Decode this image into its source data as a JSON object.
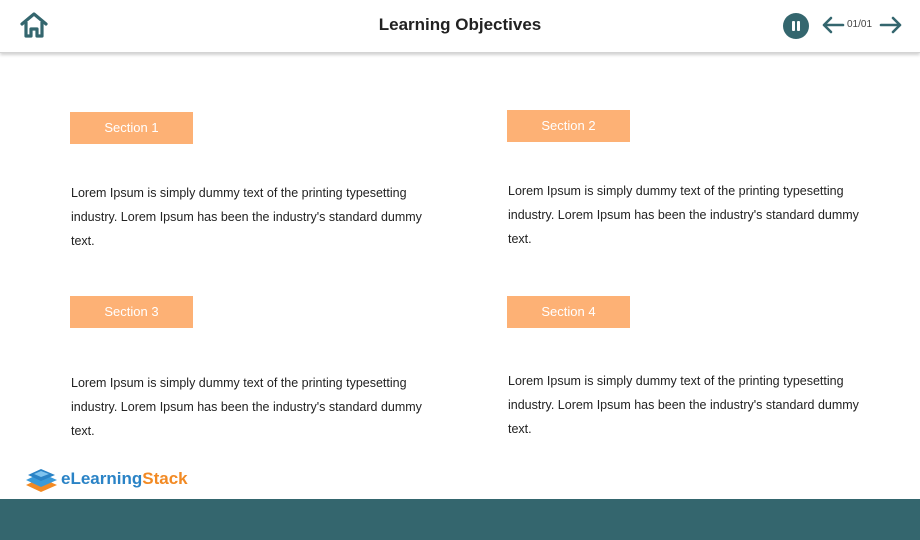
{
  "header": {
    "title": "Learning Objectives",
    "page_counter": "01/01",
    "icons": {
      "home": "home-icon",
      "pause": "pause-icon",
      "prev": "arrow-left-icon",
      "next": "arrow-right-icon"
    }
  },
  "sections": [
    {
      "label": "Section 1",
      "text": "Lorem Ipsum is simply dummy text of the printing typesetting industry. Lorem Ipsum has been the industry's standard dummy text."
    },
    {
      "label": "Section 2",
      "text": "Lorem Ipsum is simply dummy text of the printing typesetting industry. Lorem Ipsum has been the industry's standard dummy text."
    },
    {
      "label": "Section 3",
      "text": "Lorem Ipsum is simply dummy text of the printing typesetting industry. Lorem Ipsum has been the industry's standard dummy text."
    },
    {
      "label": "Section 4",
      "text": "Lorem Ipsum is simply dummy text of the printing typesetting industry. Lorem Ipsum has been the industry's standard dummy text."
    }
  ],
  "logo": {
    "part1": "eLearning",
    "part2": "Stack"
  },
  "colors": {
    "accent_teal": "#34666e",
    "section_label_bg": "#fdb175",
    "logo_blue": "#2a83c6",
    "logo_orange": "#f28a24"
  }
}
